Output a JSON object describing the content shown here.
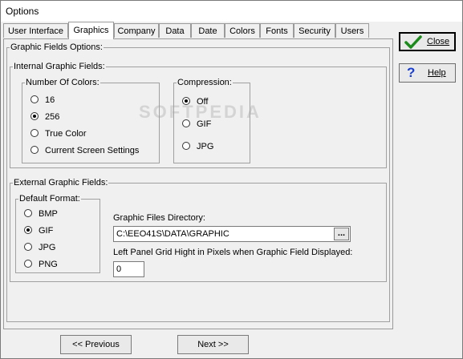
{
  "window": {
    "title": "Options"
  },
  "tabs": [
    {
      "label": "User Interface"
    },
    {
      "label": "Graphics"
    },
    {
      "label": "Company"
    },
    {
      "label": "Data"
    },
    {
      "label": "Date"
    },
    {
      "label": "Colors"
    },
    {
      "label": "Fonts"
    },
    {
      "label": "Security"
    },
    {
      "label": "Users"
    }
  ],
  "active_tab": "Graphics",
  "panel": {
    "group_title": "Graphic Fields Options:",
    "internal": {
      "title": "Internal Graphic Fields:",
      "colors": {
        "title": "Number Of Colors:",
        "options": [
          "16",
          "256",
          "True Color",
          "Current Screen Settings"
        ],
        "selected": "256"
      },
      "compression": {
        "title": "Compression:",
        "options": [
          "Off",
          "GIF",
          "JPG"
        ],
        "selected": "Off"
      }
    },
    "external": {
      "title": "External Graphic Fields:",
      "format": {
        "title": "Default Format:",
        "options": [
          "BMP",
          "GIF",
          "JPG",
          "PNG"
        ],
        "selected": "GIF"
      },
      "directory_label": "Graphic Files Directory:",
      "directory_value": "C:\\EEO41S\\DATA\\GRAPHIC",
      "browse_label": "...",
      "grid_label": "Left Panel Grid Hight in Pixels when Graphic Field Displayed:",
      "grid_value": "0"
    }
  },
  "buttons": {
    "close": "Close",
    "help": "Help",
    "previous": "<< Previous",
    "next": "Next >>"
  },
  "watermark": "SOFTPEDIA",
  "colors": {
    "check": "#1a8a1a",
    "help": "#1a3fd0"
  }
}
